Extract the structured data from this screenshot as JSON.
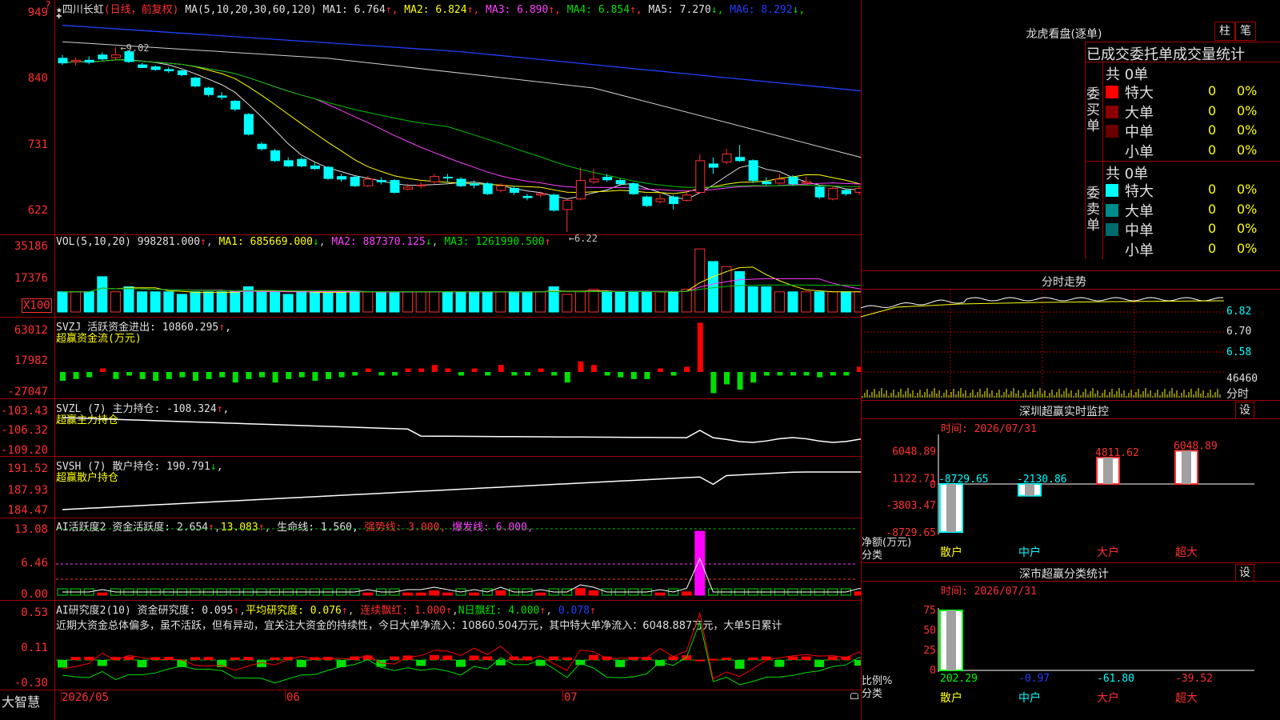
{
  "main": {
    "stock_name": "四川长虹",
    "period_tag": "(日线，前复权)",
    "ma_header": "MA(5,10,20,30,60,120)",
    "ma_values": [
      {
        "label": "MA1:",
        "value": "6.764",
        "arrow": "↑",
        "color": "#e0e0e0"
      },
      {
        "label": "MA2:",
        "value": "6.824",
        "arrow": "↑",
        "color": "#ffff00"
      },
      {
        "label": "MA3:",
        "value": "6.890",
        "arrow": "↑",
        "color": "#ff40ff"
      },
      {
        "label": "MA4:",
        "value": "6.854",
        "arrow": "↑",
        "color": "#00e000"
      },
      {
        "label": "MA5:",
        "value": "7.270",
        "arrow": "↓",
        "color": "#e0e0e0"
      },
      {
        "label": "MA6:",
        "value": "8.292",
        "arrow": "↓",
        "color": "#2040ff"
      }
    ],
    "y_ticks": [
      "949",
      "840",
      "731",
      "622"
    ],
    "annot_high": "9.02",
    "annot_low": "6.22",
    "help_mark": "?"
  },
  "vol": {
    "header": "VOL(5,10,20)",
    "value": "998281.000",
    "ma": [
      {
        "label": "MA1:",
        "value": "685669.000",
        "arrow": "↓"
      },
      {
        "label": "MA2:",
        "value": "887370.125",
        "arrow": "↓"
      },
      {
        "label": "MA3:",
        "value": "1261990.500",
        "arrow": "↑"
      }
    ],
    "y_ticks": [
      "35186",
      "17376"
    ],
    "unit": "X100"
  },
  "svzj": {
    "line1": "SVZJ  活跃资金进出: 10860.295",
    "line2": "超赢资金流(万元)",
    "y_ticks": [
      "63012",
      "17982",
      "-27047"
    ]
  },
  "svzl": {
    "line1": "SVZL  (7) 主力持仓: -108.324",
    "line2": "超赢主力持仓",
    "y_ticks": [
      "-103.43",
      "-106.32",
      "-109.20"
    ]
  },
  "svsh": {
    "line1": "SVSH  (7) 散户持仓: 190.791",
    "line2": "超赢散户持仓",
    "y_ticks": [
      "191.52",
      "187.93",
      "184.47"
    ]
  },
  "ai_active": {
    "title": "AI活跃度2 资金活跃度: 2.654",
    "v2": "13.083",
    "life": "生命线: 1.560,",
    "strong": "强势线: 3.000,",
    "burst": "爆发线: 6.000,",
    "y_ticks": [
      "13.08",
      "6.46",
      "0.00"
    ]
  },
  "ai_research": {
    "title": "AI研究度2(10) 资金研究度: 0.095",
    "avg": "平均研究度: 0.076",
    "cont": "连续飘红: 1.000",
    "nday": "N日飘红: 4.000",
    "last": "0.078",
    "comment": "近期大资金总体偏多，虽不活跃，但有异动，宜关注大资金的持续性，今日大单净流入：10860.504万元，其中特大单净流入：6048.887万元，大单5日累计",
    "y_ticks": [
      "0.53",
      "0.11",
      "-0.30"
    ]
  },
  "bottom": {
    "brand": "大智慧",
    "dates": [
      "2026/05",
      "06",
      "07"
    ]
  },
  "right": {
    "dragon_title": "龙虎看盘(逐单)",
    "btn_zhu": "柱",
    "btn_bi": "笔",
    "stats_title": "已成交委托单成交量统计",
    "buy_label": "委买单",
    "sell_label": "委卖单",
    "buy_total": "共 0单",
    "sell_total": "共 0单",
    "buy_rows": [
      {
        "name": "特大",
        "count": "0",
        "pct": "0%",
        "color": "#ff0000"
      },
      {
        "name": "大单",
        "count": "0",
        "pct": "0%",
        "color": "#8b0000"
      },
      {
        "name": "中单",
        "count": "0",
        "pct": "0%",
        "color": "#6b0000"
      },
      {
        "name": "小单",
        "count": "0",
        "pct": "0%",
        "color": "#000000"
      }
    ],
    "sell_rows": [
      {
        "name": "特大",
        "count": "0",
        "pct": "0%",
        "color": "#00ffff"
      },
      {
        "name": "大单",
        "count": "0",
        "pct": "0%",
        "color": "#008b8b"
      },
      {
        "name": "中单",
        "count": "0",
        "pct": "0%",
        "color": "#006b6b"
      },
      {
        "name": "小单",
        "count": "0",
        "pct": "0%",
        "color": "#000000"
      }
    ],
    "intraday_title": "分时走势",
    "intraday_y": [
      "6.82",
      "6.70",
      "6.58"
    ],
    "intraday_vol": "46460",
    "intraday_tab": "分时",
    "monitor_title": "深圳超赢实时监控",
    "monitor_btn": "设",
    "monitor_time": "时间: 2026/07/31",
    "monitor_y": [
      "6048.89",
      "1122.71",
      "0",
      "-3803.47",
      "-8729.65"
    ],
    "monitor_ylabel1": "净额(万元)",
    "monitor_ylabel2": "分类",
    "monitor_bars": [
      {
        "cat": "散户",
        "value": -8729.65,
        "label": "-8729.65"
      },
      {
        "cat": "中户",
        "value": -2130.86,
        "label": "-2130.86"
      },
      {
        "cat": "大户",
        "value": 4811.62,
        "label": "4811.62"
      },
      {
        "cat": "超大",
        "value": 6048.89,
        "label": "6048.89"
      }
    ],
    "class_title": "深市超赢分类统计",
    "class_btn": "设",
    "class_time": "时间: 2026/07/31",
    "class_y": [
      "75",
      "50",
      "25",
      "0"
    ],
    "class_ylabel1": "比例%",
    "class_ylabel2": "分类",
    "class_vals": [
      {
        "cat": "散户",
        "label": "202.29",
        "color": "#00ff00"
      },
      {
        "cat": "中户",
        "label": "-0.97",
        "color": "#2040ff"
      },
      {
        "cat": "大户",
        "label": "-61.80",
        "color": "#00ffff"
      },
      {
        "cat": "超大",
        "label": "-39.52",
        "color": "#ff3030"
      }
    ]
  },
  "chart_data": {
    "type": "candlestick",
    "candles": [
      [
        8.85,
        8.78,
        8.9,
        8.75
      ],
      [
        8.8,
        8.82,
        8.86,
        8.74
      ],
      [
        8.82,
        8.79,
        8.88,
        8.76
      ],
      [
        8.9,
        8.84,
        8.94,
        8.82
      ],
      [
        8.86,
        8.9,
        9.02,
        8.83
      ],
      [
        8.95,
        8.8,
        8.96,
        8.78
      ],
      [
        8.75,
        8.71,
        8.78,
        8.7
      ],
      [
        8.72,
        8.68,
        8.74,
        8.66
      ],
      [
        8.68,
        8.66,
        8.72,
        8.63
      ],
      [
        8.66,
        8.6,
        8.68,
        8.58
      ],
      [
        8.55,
        8.43,
        8.57,
        8.41
      ],
      [
        8.4,
        8.3,
        8.42,
        8.27
      ],
      [
        8.28,
        8.26,
        8.34,
        8.22
      ],
      [
        8.2,
        8.08,
        8.22,
        8.05
      ],
      [
        8.0,
        7.7,
        8.02,
        7.68
      ],
      [
        7.55,
        7.48,
        7.58,
        7.45
      ],
      [
        7.45,
        7.3,
        7.48,
        7.28
      ],
      [
        7.3,
        7.22,
        7.35,
        7.2
      ],
      [
        7.32,
        7.22,
        7.35,
        7.2
      ],
      [
        7.22,
        7.18,
        7.27,
        7.16
      ],
      [
        7.2,
        7.03,
        7.22,
        7.01
      ],
      [
        7.06,
        7.02,
        7.1,
        6.98
      ],
      [
        7.05,
        6.92,
        7.07,
        6.9
      ],
      [
        6.92,
        7.02,
        7.07,
        6.9
      ],
      [
        7.0,
        6.98,
        7.05,
        6.94
      ],
      [
        7.0,
        6.82,
        7.02,
        6.8
      ],
      [
        6.87,
        6.9,
        6.95,
        6.85
      ],
      [
        6.92,
        6.93,
        6.98,
        6.88
      ],
      [
        6.98,
        7.06,
        7.1,
        6.95
      ],
      [
        7.05,
        7.04,
        7.1,
        6.97
      ],
      [
        7.02,
        6.92,
        7.05,
        6.9
      ],
      [
        6.95,
        6.93,
        7.0,
        6.88
      ],
      [
        6.95,
        6.8,
        6.98,
        6.78
      ],
      [
        6.85,
        6.92,
        6.96,
        6.82
      ],
      [
        6.88,
        6.82,
        6.92,
        6.78
      ],
      [
        6.76,
        6.74,
        6.8,
        6.7
      ],
      [
        6.78,
        6.8,
        6.83,
        6.74
      ],
      [
        6.78,
        6.55,
        6.8,
        6.53
      ],
      [
        6.56,
        6.7,
        6.72,
        6.22
      ],
      [
        6.72,
        7.0,
        7.2,
        6.7
      ],
      [
        6.98,
        7.02,
        7.18,
        6.95
      ],
      [
        7.05,
        7.01,
        7.1,
        6.98
      ],
      [
        7.0,
        6.95,
        7.03,
        6.92
      ],
      [
        6.95,
        6.8,
        6.97,
        6.78
      ],
      [
        6.75,
        6.62,
        6.77,
        6.6
      ],
      [
        6.68,
        6.72,
        6.8,
        6.65
      ],
      [
        6.75,
        6.65,
        6.78,
        6.56
      ],
      [
        6.7,
        6.78,
        6.85,
        6.68
      ],
      [
        6.82,
        7.3,
        7.4,
        6.8
      ],
      [
        7.25,
        7.2,
        7.35,
        7.1
      ],
      [
        7.28,
        7.4,
        7.48,
        7.25
      ],
      [
        7.35,
        7.3,
        7.54,
        7.28
      ],
      [
        7.3,
        7.0,
        7.32,
        6.96
      ],
      [
        6.98,
        6.95,
        7.05,
        6.93
      ],
      [
        6.96,
        7.02,
        7.1,
        6.94
      ],
      [
        7.05,
        6.95,
        7.08,
        6.92
      ],
      [
        6.96,
        6.98,
        7.06,
        6.93
      ],
      [
        6.9,
        6.75,
        6.92,
        6.72
      ],
      [
        6.72,
        6.88,
        6.92,
        6.7
      ],
      [
        6.85,
        6.8,
        6.88,
        6.77
      ],
      [
        6.82,
        6.88,
        6.92,
        6.78
      ],
      [
        6.85,
        6.78,
        6.88,
        6.77
      ],
      [
        6.8,
        6.82,
        6.86,
        6.76
      ],
      [
        6.8,
        6.9,
        6.95,
        6.78
      ]
    ],
    "volume": [
      8,
      8,
      8,
      14,
      8,
      10,
      8,
      8,
      8,
      7,
      8,
      8,
      8,
      8,
      10,
      8,
      8,
      7,
      8,
      8,
      8,
      8,
      8,
      8,
      8,
      8,
      8,
      8,
      8,
      8,
      8,
      8,
      8,
      8,
      8,
      8,
      8,
      10,
      7,
      8,
      9,
      8,
      8,
      8,
      8,
      8,
      8,
      9,
      25,
      20,
      18,
      16,
      10,
      10,
      8,
      8,
      8,
      8,
      8,
      8,
      8,
      6,
      7,
      10
    ],
    "flow": [
      -5,
      -4,
      -3,
      2,
      -4,
      -2,
      -4,
      -5,
      -4,
      -3,
      -5,
      -4,
      -3,
      -6,
      -4,
      -3,
      -6,
      -4,
      -3,
      -5,
      -4,
      -3,
      -2,
      2,
      -2,
      -2,
      2,
      2,
      4,
      2,
      -2,
      2,
      -2,
      4,
      -2,
      -2,
      2,
      -2,
      -6,
      6,
      4,
      -2,
      -3,
      -4,
      -4,
      2,
      -2,
      3,
      28,
      -12,
      -7,
      -10,
      -6,
      -2,
      -2,
      -2,
      -2,
      -3,
      -2,
      -2,
      3,
      -2,
      -2,
      5
    ],
    "ylim_main": [
      6.22,
      9.49
    ],
    "x_dates": [
      "2026/05",
      "06",
      "07"
    ]
  }
}
